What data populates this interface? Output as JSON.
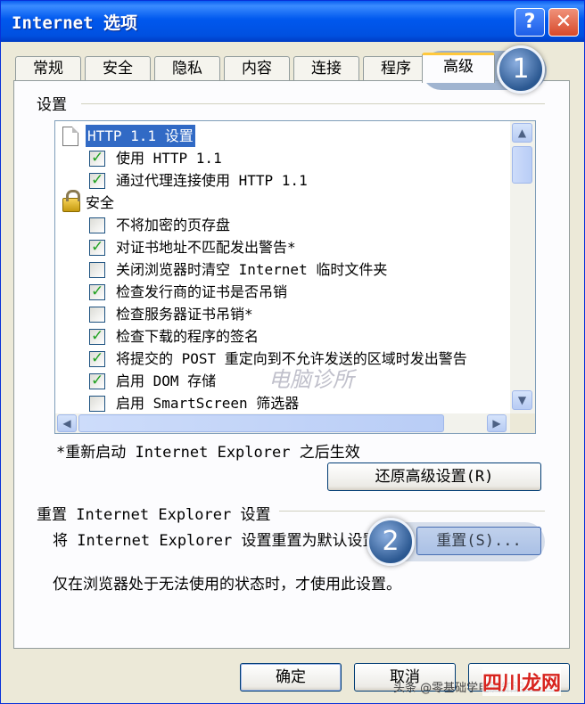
{
  "window": {
    "title": "Internet 选项"
  },
  "titlebar_buttons": {
    "help": "?",
    "close": "✕"
  },
  "tabs": [
    {
      "label": "常规"
    },
    {
      "label": "安全"
    },
    {
      "label": "隐私"
    },
    {
      "label": "内容"
    },
    {
      "label": "连接"
    },
    {
      "label": "程序"
    },
    {
      "label": "高级"
    }
  ],
  "settings_group": {
    "label": "设置"
  },
  "settings_list": {
    "heading_http": "HTTP 1.1 设置",
    "use_http11": "使用 HTTP 1.1",
    "proxy_http11": "通过代理连接使用 HTTP 1.1",
    "heading_security": "安全",
    "items": [
      {
        "label": "不将加密的页存盘",
        "checked": false
      },
      {
        "label": "对证书地址不匹配发出警告*",
        "checked": true
      },
      {
        "label": "关闭浏览器时清空 Internet 临时文件夹",
        "checked": false
      },
      {
        "label": "检查发行商的证书是否吊销",
        "checked": true
      },
      {
        "label": "检查服务器证书吊销*",
        "checked": false
      },
      {
        "label": "检查下载的程序的签名",
        "checked": true
      },
      {
        "label": "将提交的 POST 重定向到不允许发送的区域时发出警告",
        "checked": true
      },
      {
        "label": "启用 DOM 存储",
        "checked": true
      },
      {
        "label": "启用 SmartScreen 筛选器",
        "checked": false
      }
    ]
  },
  "restart_note": "*重新启动 Internet Explorer 之后生效",
  "restore_button": "还原高级设置(R)",
  "reset_group": {
    "label": "重置 Internet Explorer 设置",
    "description": "将 Internet Explorer 设置重置为默认设置。",
    "button": "重置(S)...",
    "note": "仅在浏览器处于无法使用的状态时，才使用此设置。"
  },
  "footer": {
    "ok": "确定",
    "cancel": "取消"
  },
  "callouts": {
    "one": "1",
    "two": "2"
  },
  "watermarks": {
    "center": "电脑诊所",
    "corner_text": "头条 @零基础学电脑知识",
    "corner_logo": "四川龙网"
  },
  "colors": {
    "title_blue": "#0058ee",
    "selection": "#316ac5",
    "badge": "#2b5891"
  }
}
